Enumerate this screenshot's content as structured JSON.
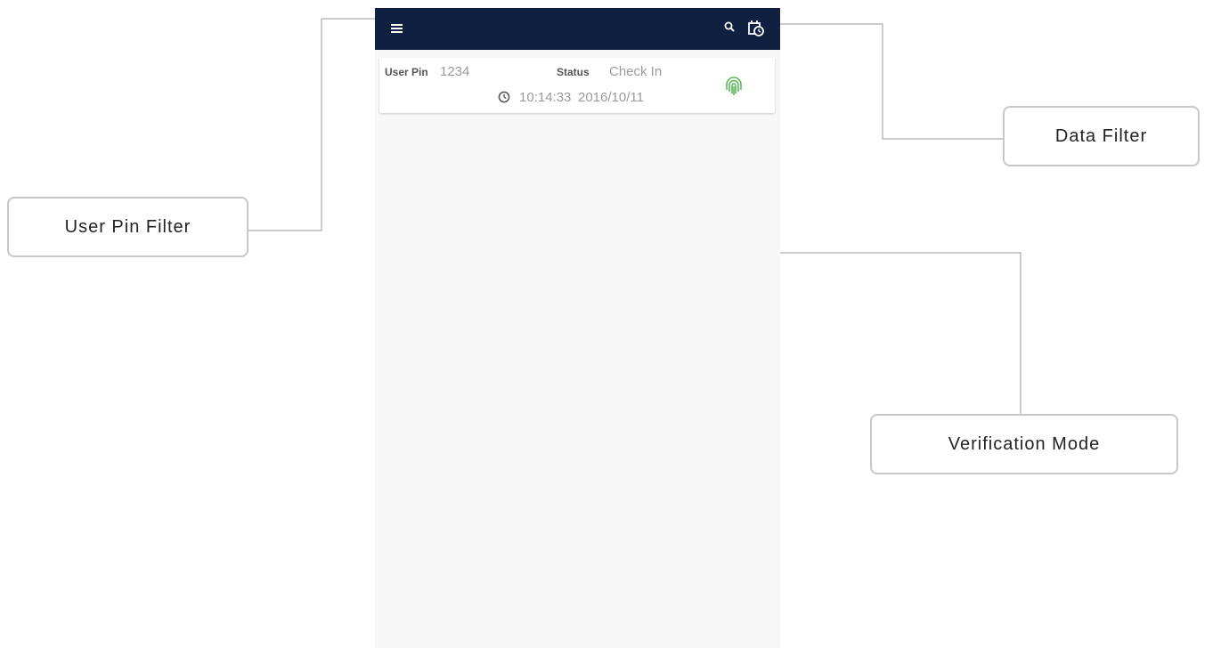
{
  "app": {
    "appbar": {
      "menu_icon": "hamburger-menu-icon",
      "search_icon": "search-icon",
      "filter_icon": "calendar-clock-icon"
    },
    "records": [
      {
        "user_pin_label": "User Pin",
        "user_pin": "1234",
        "status_label": "Status",
        "status": "Check In",
        "time": "10:14:33",
        "date": "2016/10/11",
        "verification_icon": "fingerprint-icon",
        "verification_color": "#5cb85c"
      }
    ]
  },
  "callouts": {
    "user_pin_filter": "User Pin Filter",
    "data_filter": "Data Filter",
    "verification_mode": "Verification Mode"
  },
  "colors": {
    "appbar": "#0f2040",
    "background": "#f7f7f7",
    "callout_border": "#c8c8c8"
  }
}
